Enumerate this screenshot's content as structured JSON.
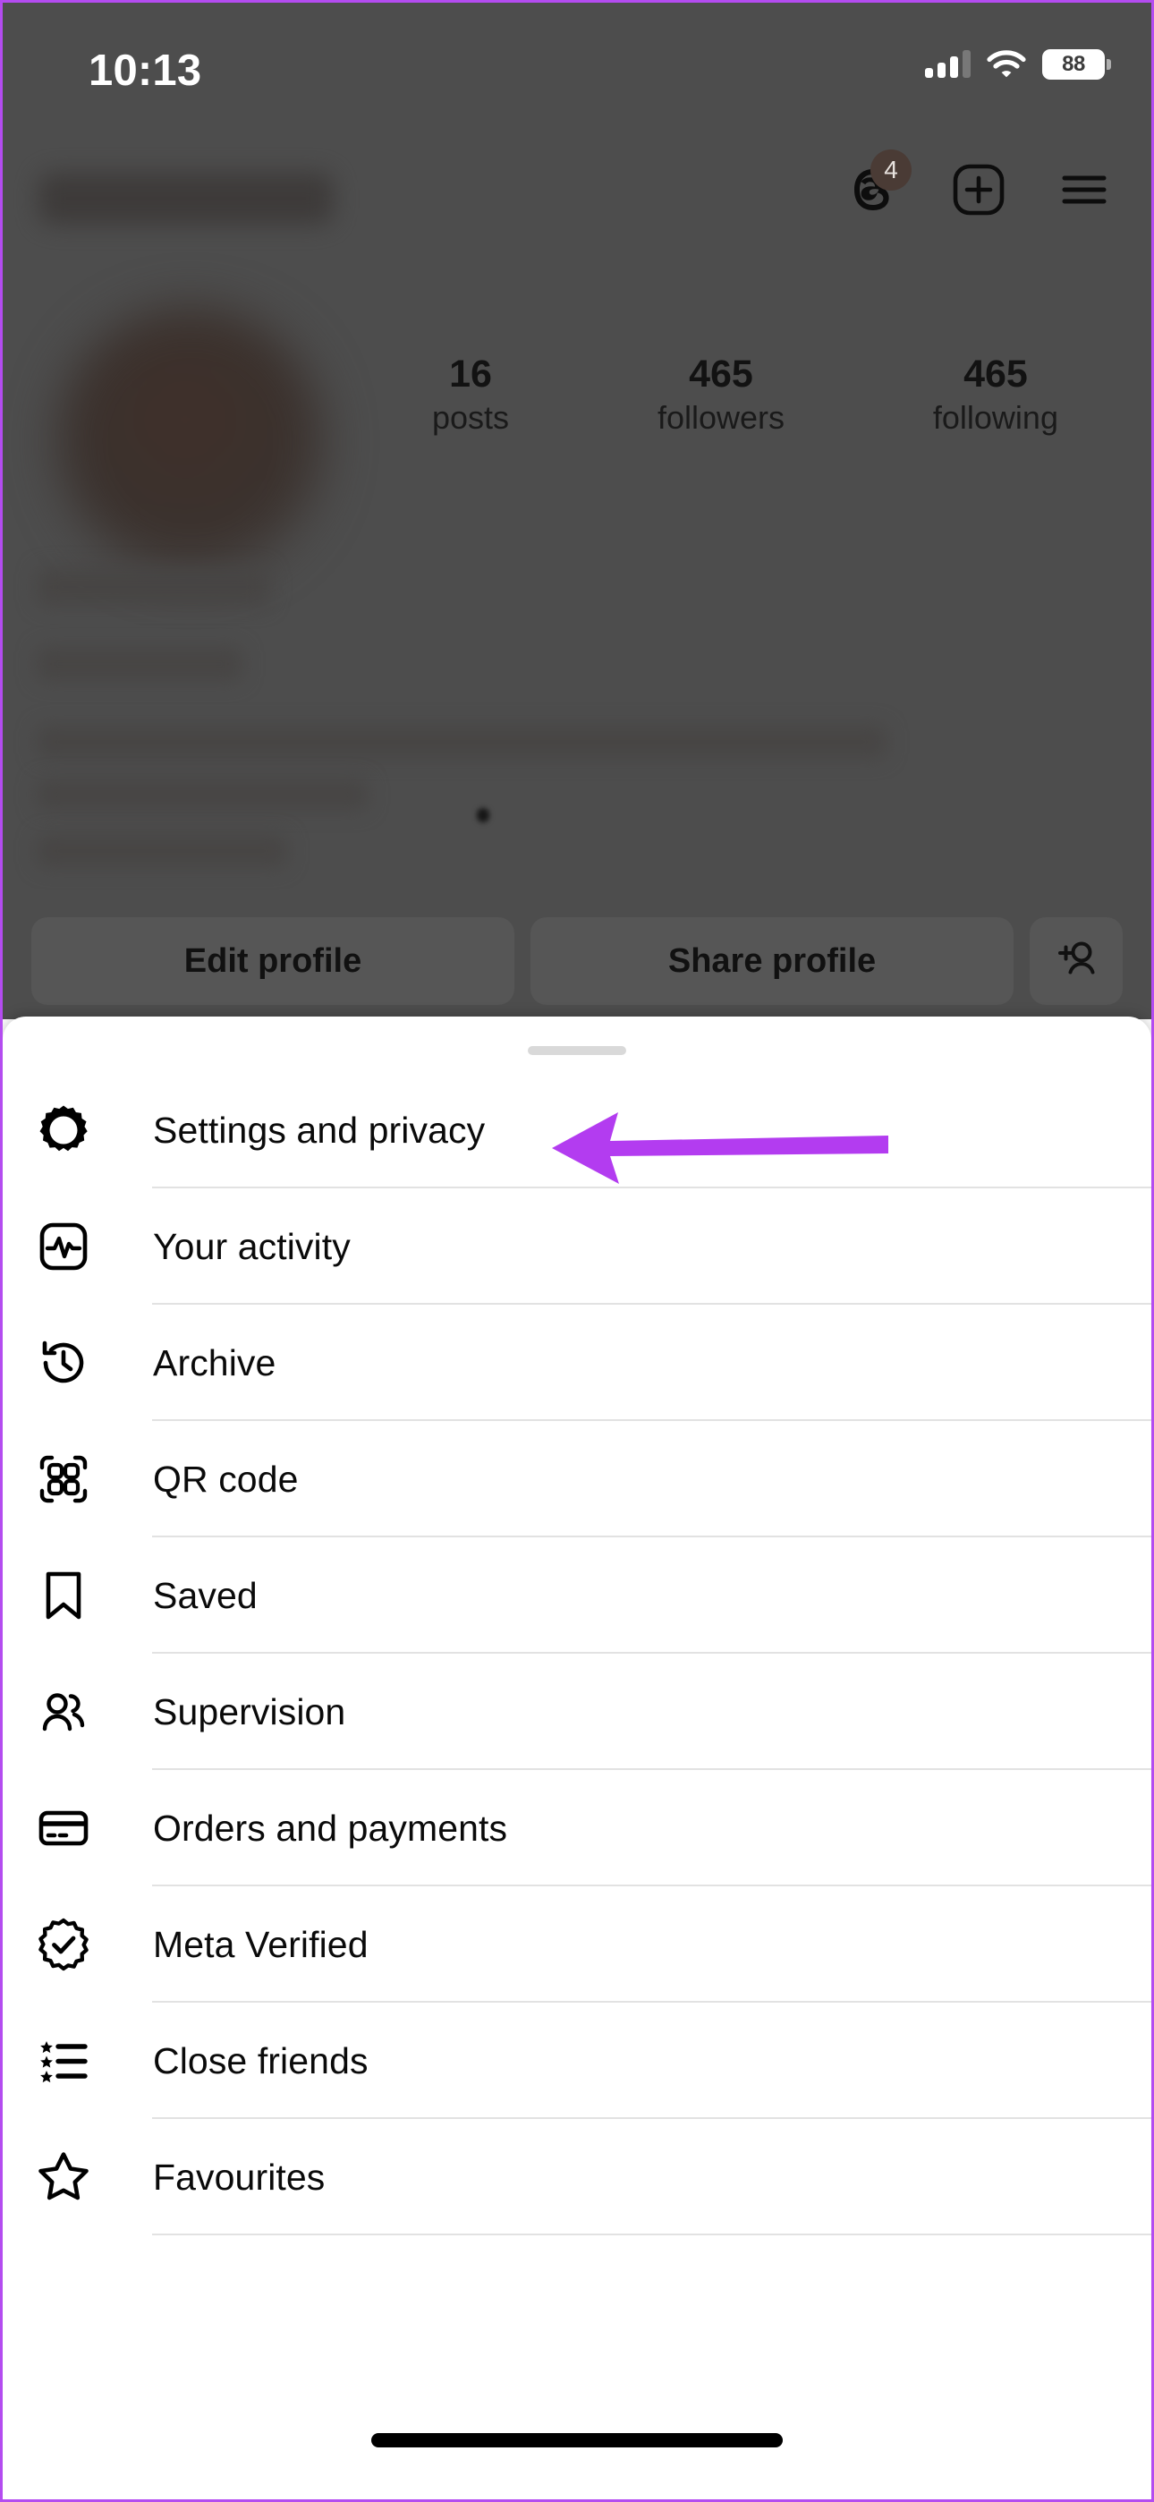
{
  "status_bar": {
    "time": "10:13",
    "battery_level": "88",
    "signal_icon": "cellular-signal-icon",
    "wifi_icon": "wifi-icon",
    "battery_icon": "battery-icon"
  },
  "profile": {
    "username_redacted": "",
    "topnav": {
      "threads_icon": "threads-icon",
      "threads_badge_count": "4",
      "create_icon": "plus-square-icon",
      "menu_icon": "hamburger-menu-icon"
    },
    "stats": [
      {
        "value": "16",
        "label": "posts"
      },
      {
        "value": "465",
        "label": "followers"
      },
      {
        "value": "465",
        "label": "following"
      }
    ],
    "actions": {
      "edit_profile": "Edit profile",
      "share_profile": "Share profile",
      "add_person_icon": "add-person-icon"
    }
  },
  "sheet": {
    "grabber": "sheet-grabber-handle",
    "items": [
      {
        "label": "Settings and privacy",
        "icon": "gear-icon"
      },
      {
        "label": "Your activity",
        "icon": "activity-chart-icon"
      },
      {
        "label": "Archive",
        "icon": "clock-rewind-icon"
      },
      {
        "label": "QR code",
        "icon": "qr-code-icon"
      },
      {
        "label": "Saved",
        "icon": "bookmark-icon"
      },
      {
        "label": "Supervision",
        "icon": "people-icon"
      },
      {
        "label": "Orders and payments",
        "icon": "credit-card-icon"
      },
      {
        "label": "Meta Verified",
        "icon": "verified-badge-icon"
      },
      {
        "label": "Close friends",
        "icon": "star-list-icon"
      },
      {
        "label": "Favourites",
        "icon": "star-icon"
      }
    ]
  },
  "annotation": {
    "arrow_icon": "left-pointing-arrow-annotation",
    "arrow_color": "#b33cf0",
    "points_to": "Settings and privacy"
  },
  "colors": {
    "accent_purple": "#b33cf0",
    "dimmed_backdrop": "#4d4d4d",
    "sheet_background": "#ffffff",
    "divider": "#e2e2e2",
    "badge_brown": "#4a3b35"
  },
  "home_indicator": "home-indicator"
}
